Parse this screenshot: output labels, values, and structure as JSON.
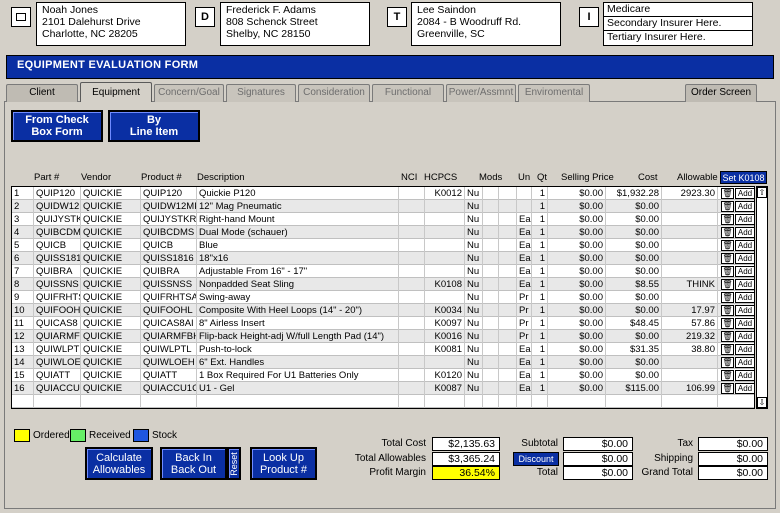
{
  "cards": [
    {
      "tag": "",
      "lines": [
        "Noah Jones",
        "2101 Dalehurst Drive",
        "Charlotte, NC 28205"
      ]
    },
    {
      "tag": "D",
      "lines": [
        "Frederick F. Adams",
        "808 Schenck Street",
        "Shelby, NC 28150"
      ]
    },
    {
      "tag": "T",
      "lines": [
        "Lee Saindon",
        "2084 - B Woodruff Rd.",
        "Greenville, SC"
      ]
    },
    {
      "tag": "I",
      "lines": [
        "Medicare",
        "Secondary  Insurer Here.",
        "Tertiary Insurer Here."
      ]
    }
  ],
  "form_title": "EQUIPMENT EVALUATION FORM",
  "tabs": [
    "Client",
    "Equipment",
    "Concern/Goal",
    "Signatures",
    "Consideration",
    "Functional",
    "Power/Assmnt",
    "Enviromental",
    "Order Screen"
  ],
  "mode_buttons": {
    "check_box": [
      "From Check",
      "Box Form"
    ],
    "line_item": [
      "By",
      "Line Item"
    ]
  },
  "columns": {
    "part": "Part #",
    "vendor": "Vendor",
    "product": "Product #",
    "description": "Description",
    "nci": "NCI",
    "hcpcs": "HCPCS",
    "mods": "Mods",
    "un": "Un",
    "qt": "Qt",
    "selling": "Selling Price",
    "cost": "Cost",
    "allowable": "Allowable"
  },
  "set_button": "Set  K0108",
  "row_buttons": {
    "add": "Add"
  },
  "rows": [
    {
      "n": "1",
      "part": "QUIP120",
      "vendor": "QUICKIE",
      "product": "QUIP120",
      "desc": "Quickie P120",
      "hcpcs": "K0012",
      "mods": "Nu",
      "un": "",
      "qt": "1",
      "sell": "$0.00",
      "cost": "$1,932.28",
      "allow": "2923.30"
    },
    {
      "n": "2",
      "part": "QUIDW12",
      "vendor": "QUICKIE",
      "product": "QUIDW12MPN",
      "desc": "12\" Mag Pneumatic",
      "hcpcs": "",
      "mods": "Nu",
      "un": "",
      "qt": "1",
      "sell": "$0.00",
      "cost": "$0.00",
      "allow": ""
    },
    {
      "n": "3",
      "part": "QUIJYSTK",
      "vendor": "QUICKIE",
      "product": "QUIJYSTKRHM",
      "desc": "Right-hand Mount",
      "hcpcs": "",
      "mods": "Nu",
      "un": "Ea",
      "qt": "1",
      "sell": "$0.00",
      "cost": "$0.00",
      "allow": ""
    },
    {
      "n": "4",
      "part": "QUIBCDM",
      "vendor": "QUICKIE",
      "product": "QUIBCDMS",
      "desc": "Dual Mode (schauer)",
      "hcpcs": "",
      "mods": "Nu",
      "un": "Ea",
      "qt": "1",
      "sell": "$0.00",
      "cost": "$0.00",
      "allow": ""
    },
    {
      "n": "5",
      "part": "QUICB",
      "vendor": "QUICKIE",
      "product": "QUICB",
      "desc": "Blue",
      "hcpcs": "",
      "mods": "Nu",
      "un": "Ea",
      "qt": "1",
      "sell": "$0.00",
      "cost": "$0.00",
      "allow": ""
    },
    {
      "n": "6",
      "part": "QUISS181",
      "vendor": "QUICKIE",
      "product": "QUISS1816",
      "desc": "18\"x16",
      "hcpcs": "",
      "mods": "Nu",
      "un": "Ea",
      "qt": "1",
      "sell": "$0.00",
      "cost": "$0.00",
      "allow": ""
    },
    {
      "n": "7",
      "part": "QUIBRA",
      "vendor": "QUICKIE",
      "product": "QUIBRA",
      "desc": "Adjustable From 16\" - 17\"",
      "hcpcs": "",
      "mods": "Nu",
      "un": "Ea",
      "qt": "1",
      "sell": "$0.00",
      "cost": "$0.00",
      "allow": ""
    },
    {
      "n": "8",
      "part": "QUISSNS",
      "vendor": "QUICKIE",
      "product": "QUISSNSS",
      "desc": "Nonpadded Seat Sling",
      "hcpcs": "K0108",
      "mods": "Nu",
      "un": "Ea",
      "qt": "1",
      "sell": "$0.00",
      "cost": "$8.55",
      "allow": "THINK"
    },
    {
      "n": "9",
      "part": "QUIFRHTS",
      "vendor": "QUICKIE",
      "product": "QUIFRHTSA",
      "desc": "Swing-away",
      "hcpcs": "",
      "mods": "Nu",
      "un": "Pr",
      "qt": "1",
      "sell": "$0.00",
      "cost": "$0.00",
      "allow": ""
    },
    {
      "n": "10",
      "part": "QUIFOOH",
      "vendor": "QUICKIE",
      "product": "QUIFOOHL",
      "desc": "Composite With Heel Loops (14\" - 20\")",
      "hcpcs": "K0034",
      "mods": "Nu",
      "un": "Pr",
      "qt": "1",
      "sell": "$0.00",
      "cost": "$0.00",
      "allow": "17.97"
    },
    {
      "n": "11",
      "part": "QUICAS8",
      "vendor": "QUICKIE",
      "product": "QUICAS8AI",
      "desc": "8\" Airless Insert",
      "hcpcs": "K0097",
      "mods": "Nu",
      "un": "Pr",
      "qt": "1",
      "sell": "$0.00",
      "cost": "$48.45",
      "allow": "57.86"
    },
    {
      "n": "12",
      "part": "QUIARMF",
      "vendor": "QUICKIE",
      "product": "QUIARMFBHA",
      "desc": "Flip-back Height-adj W/full Length Pad (14\")",
      "hcpcs": "K0016",
      "mods": "Nu",
      "un": "Pr",
      "qt": "1",
      "sell": "$0.00",
      "cost": "$0.00",
      "allow": "219.32"
    },
    {
      "n": "13",
      "part": "QUIWLPTL",
      "vendor": "QUICKIE",
      "product": "QUIWLPTL",
      "desc": "Push-to-lock",
      "hcpcs": "K0081",
      "mods": "Nu",
      "un": "Ea",
      "qt": "1",
      "sell": "$0.00",
      "cost": "$31.35",
      "allow": "38.80"
    },
    {
      "n": "14",
      "part": "QUIWLOE",
      "vendor": "QUICKIE",
      "product": "QUIWLOEH",
      "desc": "6\" Ext. Handles",
      "hcpcs": "",
      "mods": "Nu",
      "un": "Ea",
      "qt": "1",
      "sell": "$0.00",
      "cost": "$0.00",
      "allow": ""
    },
    {
      "n": "15",
      "part": "QUIATT",
      "vendor": "QUICKIE",
      "product": "QUIATT",
      "desc": "1 Box Required For U1 Batteries Only",
      "hcpcs": "K0120",
      "mods": "Nu",
      "un": "Ea",
      "qt": "1",
      "sell": "$0.00",
      "cost": "$0.00",
      "allow": ""
    },
    {
      "n": "16",
      "part": "QUIACCU",
      "vendor": "QUICKIE",
      "product": "QUIACCU1G",
      "desc": "U1 - Gel",
      "hcpcs": "K0087",
      "mods": "Nu",
      "un": "Ea",
      "qt": "1",
      "sell": "$0.00",
      "cost": "$115.00",
      "allow": "106.99"
    }
  ],
  "legend": [
    {
      "label": "Ordered",
      "color": "#ffff00"
    },
    {
      "label": "Received",
      "color": "#66ee66"
    },
    {
      "label": "Stock",
      "color": "#1e56e0"
    }
  ],
  "action_buttons": {
    "calc": [
      "Calculate",
      "Allowables"
    ],
    "back": [
      "Back In",
      "Back Out"
    ],
    "reset": "Reset",
    "lookup": [
      "Look Up",
      "Product #"
    ]
  },
  "totals": {
    "total_cost_label": "Total Cost",
    "total_cost": "$2,135.63",
    "total_allow_label": "Total Allowables",
    "total_allow": "$3,365.24",
    "margin_label": "Profit Margin",
    "margin": "36.54%",
    "subtotal_label": "Subtotal",
    "subtotal": "$0.00",
    "discount_label": "Discount",
    "discount": "$0.00",
    "total_label": "Total",
    "total": "$0.00",
    "tax_label": "Tax",
    "tax": "$0.00",
    "shipping_label": "Shipping",
    "shipping": "$0.00",
    "grand_label": "Grand Total",
    "grand": "$0.00"
  },
  "colors": {
    "accent": "#0a2fa3",
    "highlight": "#ffff00"
  }
}
